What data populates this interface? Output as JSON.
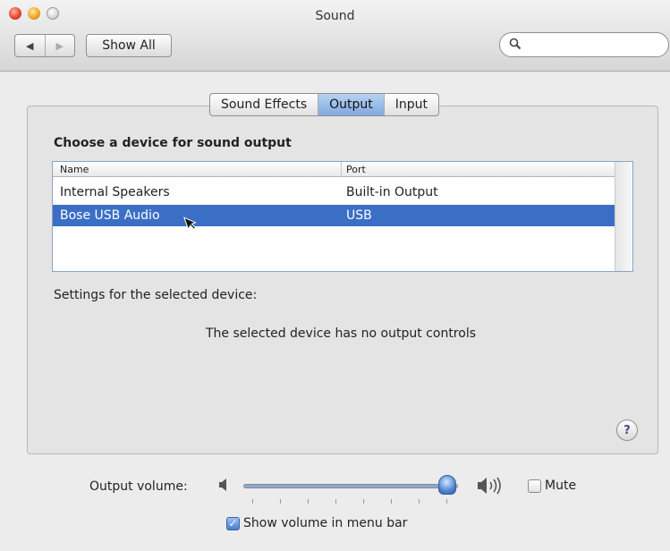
{
  "window": {
    "title": "Sound"
  },
  "toolbar": {
    "back_icon": "◀",
    "forward_icon": "▶",
    "show_all_label": "Show All",
    "search": {
      "value": "",
      "placeholder": ""
    }
  },
  "tabs": [
    {
      "label": "Sound Effects",
      "active": false
    },
    {
      "label": "Output",
      "active": true
    },
    {
      "label": "Input",
      "active": false
    }
  ],
  "output": {
    "choose_label": "Choose a device for sound output",
    "columns": {
      "name": "Name",
      "port": "Port"
    },
    "devices": [
      {
        "name": "Internal Speakers",
        "port": "Built-in Output",
        "selected": false
      },
      {
        "name": "Bose USB Audio",
        "port": "USB",
        "selected": true
      }
    ],
    "settings_label": "Settings for the selected device:",
    "no_controls_message": "The selected device has no output controls",
    "help_label": "?"
  },
  "volume": {
    "label": "Output volume:",
    "level": 0.95,
    "mute_label": "Mute",
    "mute_checked": false,
    "show_in_menu_bar_label": "Show volume in menu bar",
    "show_in_menu_bar_checked": true
  },
  "colors": {
    "selection": "#3b6fc5",
    "active_tab": "#7fa9df"
  }
}
